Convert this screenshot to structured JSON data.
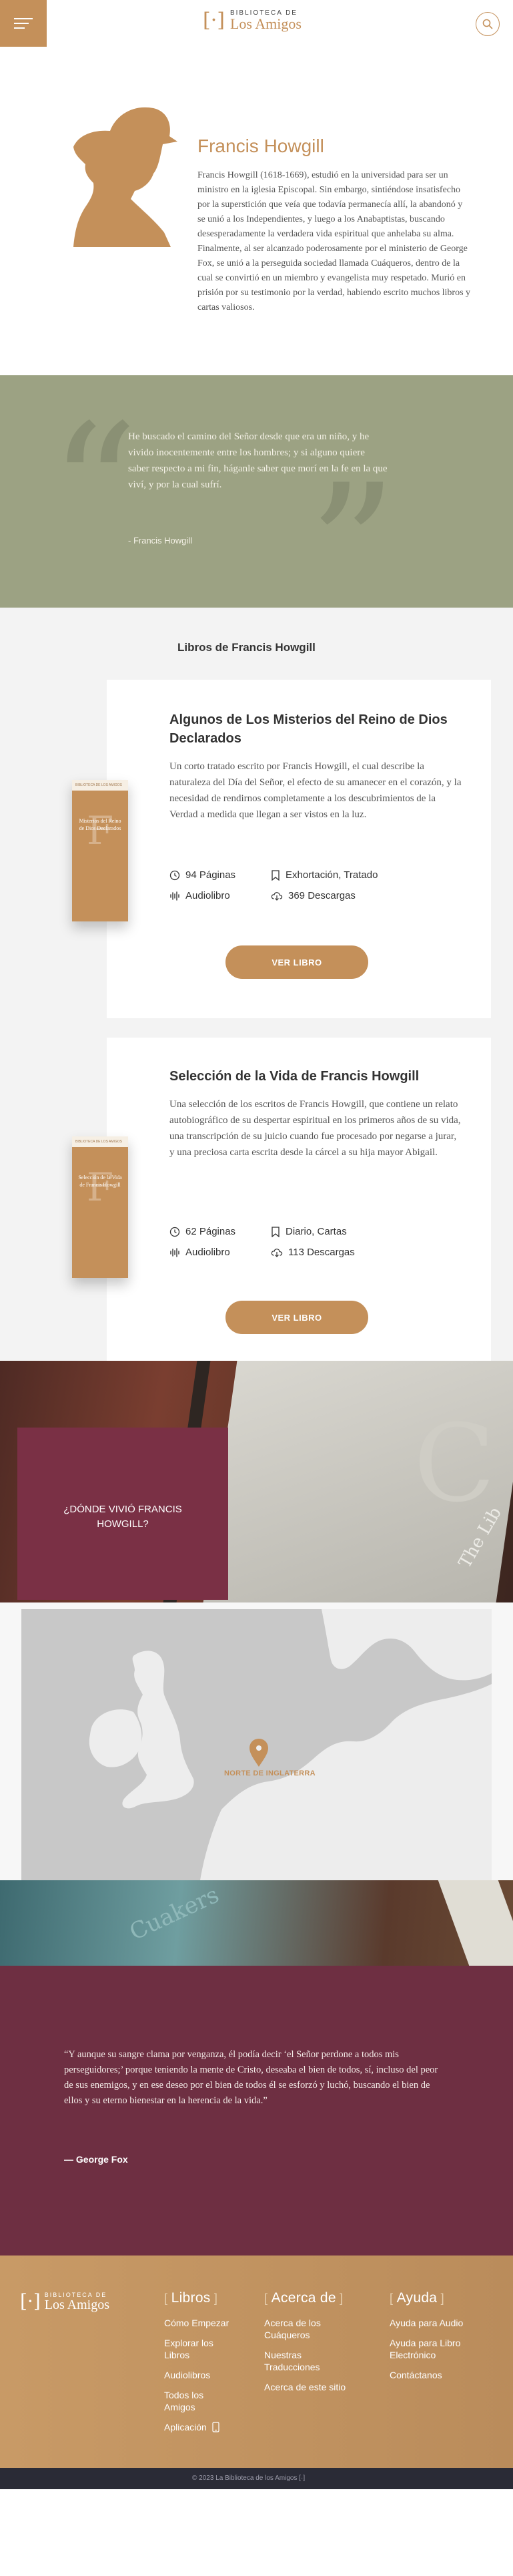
{
  "header": {
    "logo_small": "BIBLIOTECA DE",
    "logo_big": "Los Amigos",
    "logo_mark": "[·]",
    "menu_icon": "hamburger-icon",
    "search_icon": "search-icon"
  },
  "author": {
    "name": "Francis Howgill",
    "bio": "Francis Howgill (1618-1669), estudió en la universidad para ser un ministro en la iglesia Episcopal. Sin embargo, sintiéndose insatisfecho por la superstición que veía que todavía permanecía allí, la abandonó y se unió a los Independientes, y luego a los Anabaptistas, buscando desesperadamente la verdadera vida espiritual que anhelaba su alma. Finalmente, al ser alcanzado poderosamente por el ministerio de George Fox, se unió a la perseguida sociedad llamada Cuáqueros, dentro de la cual se convirtió en un miembro y evangelista muy respetado. Murió en prisión por su testimonio por la verdad, habiendo escrito muchos libros y cartas valiosos."
  },
  "quote": {
    "text": "He buscado el camino del Señor desde que era un niño, y he vivido inocentemente entre los hombres; y si alguno quiere saber respecto a mi fin, háganle saber que morí en la fe en la que viví, y por la cual sufrí.",
    "author": "- Francis Howgill"
  },
  "books_section": {
    "title": "Libros de Francis Howgill",
    "books": [
      {
        "title": "Algunos de Los Misterios del Reino de Dios Declarados",
        "cover_title": "Misterios del Reino de Dios Declarados",
        "cover_strip": "BIBLIOTECA DE LOS AMIGOS",
        "cover_letter": "F",
        "description": "Un corto tratado escrito por Francis Howgill, el cual describe la naturaleza del Día del Señor, el efecto de su amanecer en el corazón, y la necesidad de rendirnos completamente a los descubrimientos de la Verdad a medida que llegan a ser vistos en la luz.",
        "pages": "94 Páginas",
        "category": "Exhortación, Tratado",
        "audio": "Audiolibro",
        "downloads": "369 Descargas",
        "button": "VER LIBRO"
      },
      {
        "title": "Selección de la Vida de Francis Howgill",
        "cover_title": "Selección de la Vida de Francis Howgill",
        "cover_strip": "BIBLIOTECA DE LOS AMIGOS",
        "cover_letter": "F",
        "description": "Una selección de los escritos de Francis Howgill, que contiene un relato autobiográfico de su despertar espiritual en los primeros años de su vida, una transcripción de su juicio cuando fue procesado por negarse a jurar, y una preciosa carta escrita desde la cárcel a su hija mayor Abigail.",
        "pages": "62 Páginas",
        "category": "Diario, Cartas",
        "audio": "Audiolibro",
        "downloads": "113 Descargas",
        "button": "VER LIBRO"
      }
    ]
  },
  "where": {
    "title": "¿DÓNDE VIVIÓ FRANCIS HOWGILL?",
    "book_letter": "C",
    "book_text": "The Lib",
    "map_label": "NORTE DE INGLATERRA"
  },
  "teal_banner": {
    "text": "Cuakers"
  },
  "big_quote": {
    "text": "“Y aunque su sangre clama por venganza, él podía decir ‘el Señor perdone a todos mis perseguidores;’ porque teniendo la mente de Cristo, deseaba el bien de todos, sí, incluso del peor de sus enemigos, y en ese deseo por el bien de todos él se esforzó y luchó, buscando el bien de ellos y su eterno bienestar en la herencia de la vida.”",
    "author": "— George Fox"
  },
  "footer": {
    "logo_small": "BIBLIOTECA DE",
    "logo_big": "Los Amigos",
    "logo_mark": "[·]",
    "columns": [
      {
        "heading": "Libros",
        "links": [
          "Cómo Empezar",
          "Explorar los Libros",
          "Audiolibros",
          "Todos los Amigos",
          "Aplicación"
        ]
      },
      {
        "heading": "Acerca de",
        "links": [
          "Acerca de los Cuáqueros",
          "Nuestras Traducciones",
          "Acerca de este sitio"
        ]
      },
      {
        "heading": "Ayuda",
        "links": [
          "Ayuda para Audio",
          "Ayuda para Libro Electrónico",
          "Contáctanos"
        ]
      }
    ],
    "copyright": "© 2023 La Biblioteca de los Amigos [·]"
  },
  "colors": {
    "accent": "#c4905a",
    "quote_band": "#9ca283",
    "maroon": "#6e2f42",
    "footer_dark": "#2a2b36"
  }
}
